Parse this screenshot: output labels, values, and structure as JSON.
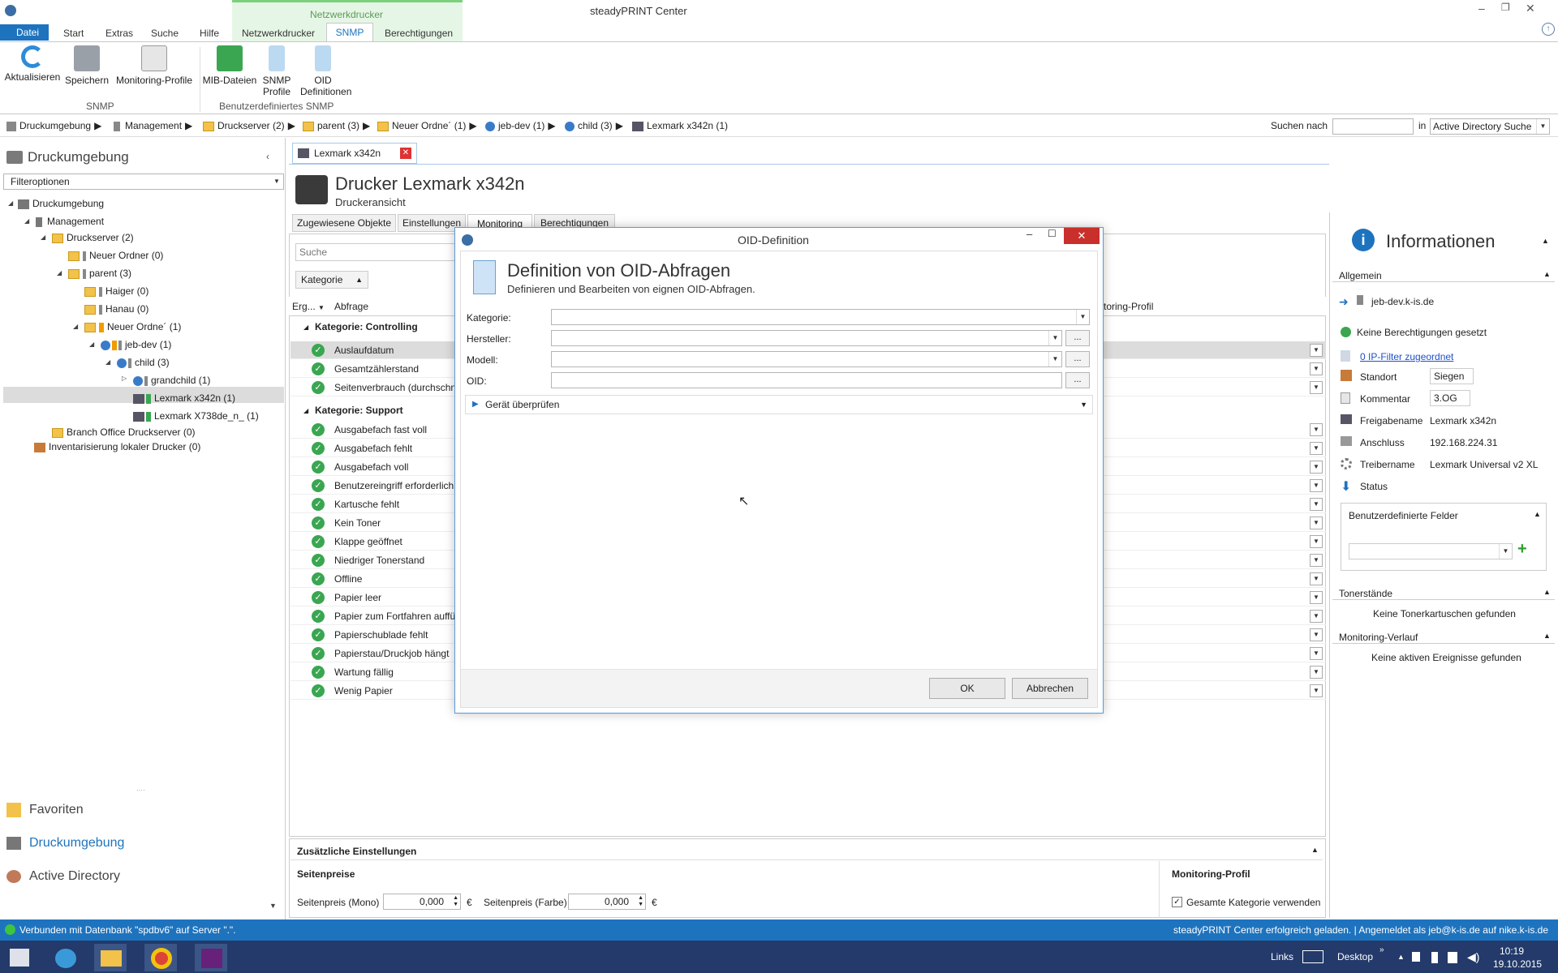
{
  "window": {
    "title": "steadyPRINT Center"
  },
  "ribbon": {
    "context_group": "Netzwerkdrucker",
    "tabs": [
      "Datei",
      "Start",
      "Extras",
      "Suche",
      "Hilfe",
      "Netzwerkdrucker",
      "SNMP",
      "Berechtigungen"
    ],
    "buttons": {
      "aktualisieren": "Aktualisieren",
      "speichern": "Speichern",
      "monitoring": "Monitoring-Profile",
      "mib": "MIB-Dateien",
      "snmp_profile": "SNMP Profile",
      "oid_def": "OID Definitionen"
    },
    "groups": {
      "snmp": "SNMP",
      "custom": "Benutzerdefiniertes SNMP"
    }
  },
  "breadcrumb": {
    "items": [
      "Druckumgebung",
      "Management",
      "Druckserver (2)",
      "parent (3)",
      "Neuer Ordne´ (1)",
      "jeb-dev (1)",
      "child (3)",
      "Lexmark x342n (1)"
    ],
    "search_label": "Suchen nach",
    "in_label": "in",
    "search_scope": "Active Directory Suche"
  },
  "sidebar": {
    "title": "Druckumgebung",
    "filter": "Filteroptionen",
    "tree": [
      "Druckumgebung",
      "Management",
      "Druckserver (2)",
      "Neuer Ordner (0)",
      "parent (3)",
      "Haiger (0)",
      "Hanau (0)",
      "Neuer Ordne´ (1)",
      "jeb-dev (1)",
      "child (3)",
      "grandchild (1)",
      "Lexmark x342n (1)",
      "Lexmark X738de_n_ (1)",
      "Branch Office Druckserver (0)",
      "Inventarisierung lokaler Drucker (0)"
    ],
    "nav": [
      "Favoriten",
      "Druckumgebung",
      "Active Directory"
    ]
  },
  "doc": {
    "tab": "Lexmark x342n",
    "title": "Drucker Lexmark x342n",
    "subtitle": "Druckeransicht",
    "subtabs": [
      "Zugewiesene Objekte",
      "Einstellungen",
      "Monitoring",
      "Berechtigungen"
    ],
    "search_placeholder": "Suche",
    "group_chip": "Kategorie",
    "col_erg": "Erg...",
    "col_abfrage": "Abfrage",
    "col_profil": "toring-Profil",
    "cat_controlling": "Kategorie: Controlling",
    "controlling": [
      "Auslaufdatum",
      "Gesamtzählerstand",
      "Seitenverbrauch (durchschn"
    ],
    "cat_support": "Kategorie: Support",
    "support": [
      "Ausgabefach fast voll",
      "Ausgabefach fehlt",
      "Ausgabefach voll",
      "Benutzereingriff erforderlich",
      "Kartusche fehlt",
      "Kein Toner",
      "Klappe geöffnet",
      "Niedriger Tonerstand",
      "Offline",
      "Papier leer",
      "Papier zum Fortfahren auffü",
      "Papierschublade fehlt",
      "Papierstau/Druckjob hängt",
      "Wartung fällig",
      "Wenig Papier"
    ]
  },
  "bottom": {
    "title": "Zusätzliche Einstellungen",
    "seitenpreise": "Seitenpreise",
    "mono_label": "Seitenpreis (Mono)",
    "mono_value": "0,000",
    "farbe_label": "Seitenpreis (Farbe)",
    "farbe_value": "0,000",
    "currency": "€",
    "monitoring_title": "Monitoring-Profil",
    "checkbox_label": "Gesamte Kategorie verwenden"
  },
  "info": {
    "title": "Informationen",
    "allgemein": "Allgemein",
    "host": "jeb-dev.k-is.de",
    "perm": "Keine Berechtigungen gesetzt",
    "ipfilter": "0 IP-Filter zugeordnet",
    "standort_label": "Standort",
    "standort": "Siegen",
    "kommentar_label": "Kommentar",
    "kommentar": "3.OG",
    "freigabe_label": "Freigabename",
    "freigabe": "Lexmark x342n",
    "anschluss_label": "Anschluss",
    "anschluss": "192.168.224.31",
    "treiber_label": "Treibername",
    "treiber": "Lexmark Universal v2 XL",
    "status_label": "Status",
    "custom_fields": "Benutzerdefinierte Felder",
    "toner": "Tonerstände",
    "toner_msg": "Keine Tonerkartuschen gefunden",
    "verlauf": "Monitoring-Verlauf",
    "verlauf_msg": "Keine aktiven Ereignisse gefunden"
  },
  "dialog": {
    "title": "OID-Definition",
    "heading": "Definition von OID-Abfragen",
    "subheading": "Definieren und Bearbeiten von eignen OID-Abfragen.",
    "kategorie": "Kategorie:",
    "hersteller": "Hersteller:",
    "modell": "Modell:",
    "oid": "OID:",
    "dots": "...",
    "expander": "Gerät überprüfen",
    "ok": "OK",
    "cancel": "Abbrechen"
  },
  "statusbar": {
    "left": "Verbunden mit Datenbank \"spdbv6\" auf Server \".\".",
    "right": "steadyPRINT Center erfolgreich geladen. | Angemeldet als jeb@k-is.de auf nike.k-is.de"
  },
  "taskbar": {
    "links": "Links",
    "desktop": "Desktop",
    "time": "10:19",
    "date": "19.10.2015"
  },
  "colors": {
    "accent": "#1e73be",
    "ribbon_context": "#7bd17b",
    "statusbar": "#1e73be",
    "taskbar": "#233a6a",
    "ok_green": "#3aa651"
  }
}
